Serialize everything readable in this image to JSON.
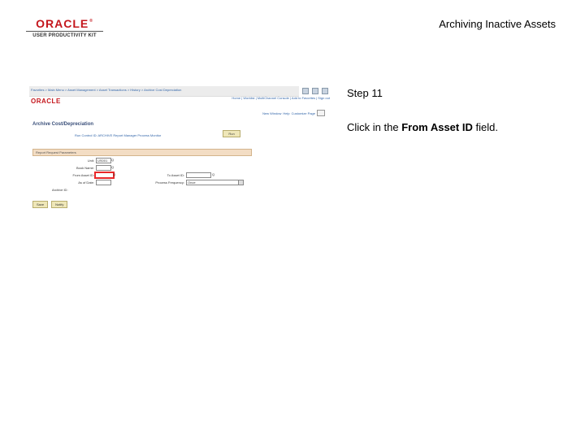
{
  "header": {
    "logo_text": "ORACLE",
    "logo_reg": "®",
    "logo_sub": "USER PRODUCTIVITY KIT",
    "doc_title": "Archiving Inactive Assets"
  },
  "screenshot": {
    "breadcrumb": "Favorites  >  Main Menu  >  Asset Management  >  Asset Transactions  >  History  >  Archive Cost Depreciation",
    "brand": "ORACLE",
    "nav_links": "Home  |  Worklist  |  MultiChannel Console  |  Add to Favorites  |  Sign out",
    "util_new_window": "New Window",
    "util_help": "Help",
    "util_customize": "Customize Page",
    "page_title": "Archive Cost/Depreciation",
    "sub_links": "Run Control ID:  ARCHIVE     Report Manager     Process Monitor",
    "run_button": "Run",
    "section_title": "Report Request Parameters",
    "labels": {
      "unit": "Unit:",
      "book_name": "Book Name:",
      "from_asset": "From Asset ID:",
      "to_asset": "To Asset ID:",
      "as_of_date": "As of Date:",
      "process_frequency": "Process Frequency:",
      "archive_id": "Archive ID:"
    },
    "values": {
      "unit": "US001",
      "book_name": "",
      "from_asset": "",
      "to_asset": "",
      "as_of_date": "",
      "process_frequency": "Once"
    },
    "lookup_glyph": "Q",
    "buttons": [
      "Save",
      "Notify"
    ]
  },
  "instruction": {
    "step": "Step 11",
    "prefix": "Click in the ",
    "target": "From Asset ID",
    "suffix": " field."
  }
}
